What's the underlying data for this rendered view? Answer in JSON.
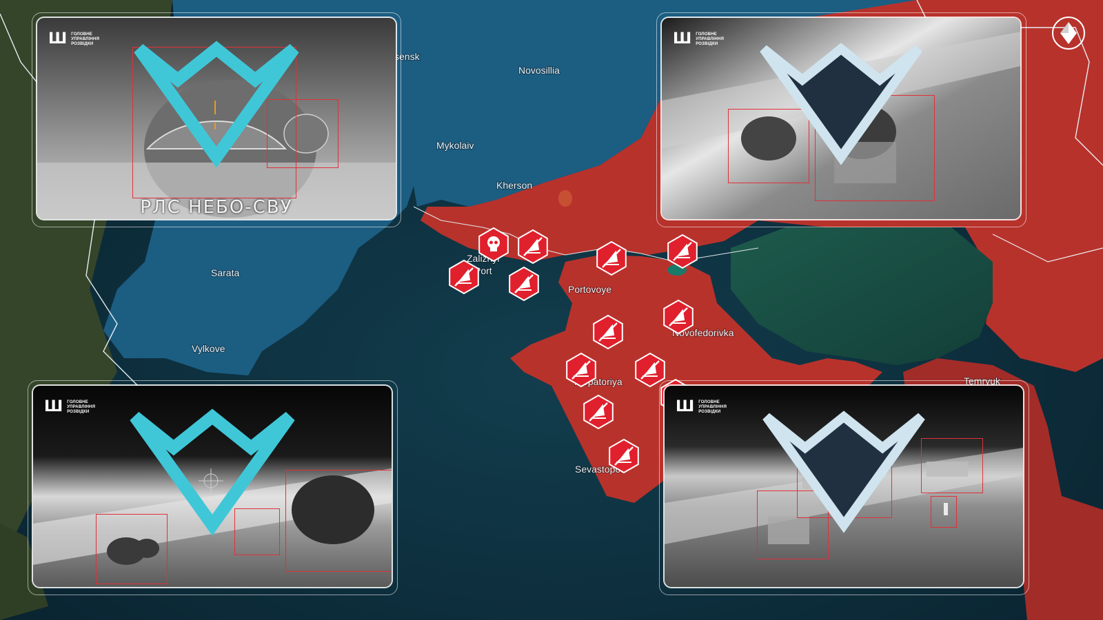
{
  "map": {
    "colors": {
      "sea": "#0c2a3a",
      "ukraine_controlled": "#1c5d82",
      "occupied": "#b8322c",
      "land_foreign": "#34452a",
      "strike_icon": "#e0202d"
    },
    "labels": [
      {
        "name": "Novosillia",
        "id": "novosillia"
      },
      {
        "name": "sensk",
        "id": "sensk"
      },
      {
        "name": "Mykolaiv",
        "id": "mykolaiv"
      },
      {
        "name": "Kherson",
        "id": "kherson"
      },
      {
        "name": "Zaliznyi",
        "id": "zaliznyi"
      },
      {
        "name": "Port",
        "id": "port"
      },
      {
        "name": "Portovoye",
        "id": "portovoye"
      },
      {
        "name": "Novofedorivka",
        "id": "novofedorivka"
      },
      {
        "name": "Yevpatoriya",
        "id": "yevpatoriya"
      },
      {
        "name": "Sevastopol",
        "id": "sevastopol"
      },
      {
        "name": "Sarata",
        "id": "sarata"
      },
      {
        "name": "Vylkove",
        "id": "vylkove"
      },
      {
        "name": "Temryuk",
        "id": "temryuk"
      }
    ],
    "strike_markers": [
      {
        "icon": "skull-icon"
      },
      {
        "icon": "radar-strike-icon"
      },
      {
        "icon": "radar-strike-icon"
      },
      {
        "icon": "radar-strike-icon"
      },
      {
        "icon": "radar-strike-icon"
      },
      {
        "icon": "radar-strike-icon"
      },
      {
        "icon": "radar-strike-icon"
      },
      {
        "icon": "radar-strike-icon"
      },
      {
        "icon": "launcher-strike-icon"
      },
      {
        "icon": "radar-strike-icon"
      },
      {
        "icon": "radar-strike-icon"
      },
      {
        "icon": "radar-strike-icon"
      },
      {
        "icon": "radar-strike-icon"
      }
    ]
  },
  "panels": {
    "top_left": {
      "org": "ГОЛОВНЕ УПРАВЛІННЯ РОЗВІДКИ",
      "caption": "РЛС НЕБО-СВУ"
    },
    "top_right": {
      "org": "ГОЛОВНЕ УПРАВЛІННЯ РОЗВІДКИ"
    },
    "bottom_left": {
      "org": "ГОЛОВНЕ УПРАВЛІННЯ РОЗВІДКИ"
    },
    "bottom_right": {
      "org": "ГОЛОВНЕ УПРАВЛІННЯ РОЗВІДКИ"
    }
  },
  "compass": {
    "icon": "north-arrow-icon"
  }
}
